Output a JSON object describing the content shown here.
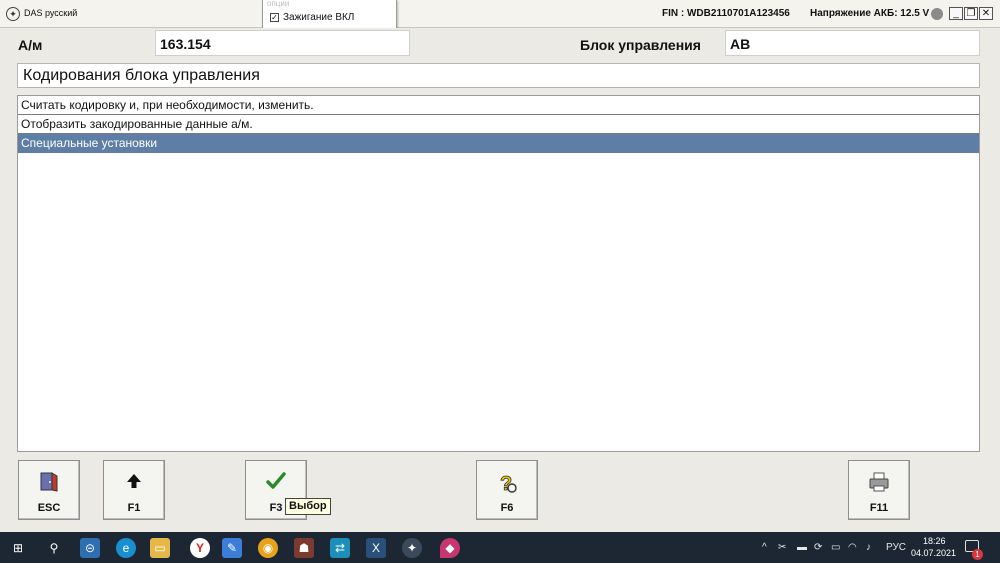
{
  "titlebar": {
    "app_title": "DAS русский",
    "fin": "FIN : WDB2110701A123456",
    "voltage": "Напряжение АКБ: 12.5 V",
    "minimize": "_",
    "restore": "❐",
    "close": "✕"
  },
  "popup": {
    "faded_text": "опции",
    "ignition_label": "Зажигание ВКЛ",
    "ignition_checked": true
  },
  "header": {
    "vehicle_label": "А/м",
    "vehicle_value": "163.154",
    "ecu_label": "Блок управления",
    "ecu_value": "AB"
  },
  "section_title": "Кодирования блока управления",
  "menu": {
    "items": [
      {
        "label": "Считать кодировку и, при необходимости, изменить."
      },
      {
        "label": "Отобразить закодированные данные а/м."
      },
      {
        "label": "Специальные установки"
      }
    ],
    "selected_index": 2
  },
  "fkeys": [
    {
      "key": "ESC",
      "icon": "exit-door-icon"
    },
    {
      "key": "F1",
      "icon": "arrow-up-icon"
    },
    {
      "key": "F3",
      "icon": "checkmark-icon"
    },
    {
      "key": "F6",
      "icon": "help-question-icon"
    },
    {
      "key": "F11",
      "icon": "printer-icon"
    }
  ],
  "tooltip": "Выбор",
  "taskbar": {
    "language": "РУС",
    "time": "18:26",
    "date": "04.07.2021",
    "notification_count": "1"
  },
  "colors": {
    "selected_row": "#5f7ea6",
    "taskbar": "#1c2733",
    "check_green": "#2a8a2a"
  }
}
